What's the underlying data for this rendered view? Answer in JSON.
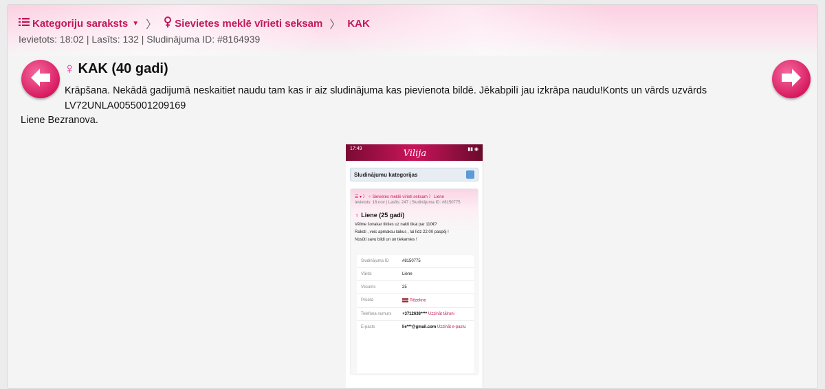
{
  "breadcrumb": {
    "categories": "Kategoriju saraksts",
    "section": "Sievietes meklē vīrieti seksam",
    "current": "KAK"
  },
  "meta": "Ievietots: 18:02 | Lasīts: 132 | Sludinājuma ID: #8164939",
  "post": {
    "title": "KAK (40 gadi)",
    "description": "Krāpšana. Nekādā gadijumā neskaitiet naudu tam kas ir aiz sludinājuma kas pievienota bildē. Jēkabpilī jau izkrāpa naudu!Konts un vārds uzvārds LV72UNLA0055001209169",
    "author": "Liene Bezranova."
  },
  "screenshot": {
    "time": "17:49",
    "logo": "Vilija",
    "category_bar": "Sludinājumu kategorijas",
    "breadcrumb_section": "Sievietes meklē vīrieti seksam",
    "breadcrumb_current": "Liene",
    "meta": "Ievietots: 16.nov | Lasīts: 247 | Sludinājuma ID: #8150775",
    "title": "Liene (25 gadi)",
    "desc_lines": [
      "Vēlme šovakar tikties uz nakti tikai par 110€?",
      "Raksti , veic apmaksu laikus , lai līdz 22:00 paspēj !",
      "Nosūti savu bildi un un tiekamies !"
    ],
    "rows": [
      {
        "k": "Sludinājuma ID",
        "v": "#8150775"
      },
      {
        "k": "Vārds",
        "v": "Liene"
      },
      {
        "k": "Vecums",
        "v": "25"
      },
      {
        "k": "Pilsēta",
        "v": "Rēzekne"
      },
      {
        "k": "Telefona numurs",
        "v": "+3712638****",
        "link": "Uzzināt tālruni"
      },
      {
        "k": "E-pasts",
        "v": "lie***@gmail.com",
        "link": "Uzzināt e-pastu"
      }
    ]
  },
  "colors": {
    "accent": "#c2185b",
    "symbol": "#e91e8c",
    "nav_button": "#d81b60"
  },
  "icons": {
    "list": "list-icon",
    "female": "female-icon",
    "prev": "arrow-left-icon",
    "next": "arrow-right-icon"
  }
}
